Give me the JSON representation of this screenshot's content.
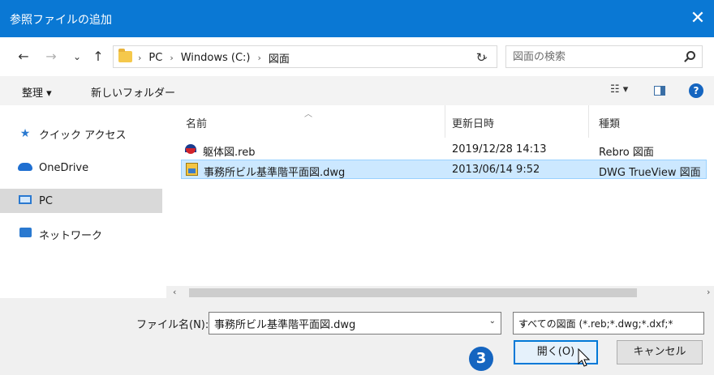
{
  "dialog": {
    "title": "参照ファイルの追加",
    "close_glyph": "✕"
  },
  "nav": {
    "back_glyph": "←",
    "forward_glyph": "→",
    "recent_glyph": "⌄",
    "up_glyph": "↑",
    "breadcrumb": [
      {
        "label": "PC"
      },
      {
        "label": "Windows (C:)"
      },
      {
        "label": "図面"
      }
    ],
    "separator": "›",
    "dropdown_glyph": "⌄",
    "refresh_glyph": "↻",
    "search_placeholder": "図面の検索"
  },
  "toolbar": {
    "organize_label": "整理 ▾",
    "new_folder_label": "新しいフォルダー",
    "view_label": "☷ ▾",
    "help_label": "?"
  },
  "sidebar": {
    "items": [
      {
        "label": "クイック アクセス",
        "icon": "star-icon",
        "selected": false
      },
      {
        "label": "OneDrive",
        "icon": "cloud-icon",
        "selected": false
      },
      {
        "label": "PC",
        "icon": "monitor-icon",
        "selected": true
      },
      {
        "label": "ネットワーク",
        "icon": "network-icon",
        "selected": false
      }
    ]
  },
  "files": {
    "columns": [
      "名前",
      "更新日時",
      "種類"
    ],
    "sort_glyph": "︿",
    "rows": [
      {
        "name": "躯体図.reb",
        "date": "2019/12/28 14:13",
        "type": "Rebro 図面",
        "icon": "rebro-file-icon",
        "selected": false
      },
      {
        "name": "事務所ビル基準階平面図.dwg",
        "date": "2013/06/14 9:52",
        "type": "DWG TrueView 図面",
        "icon": "dwg-file-icon",
        "selected": true
      }
    ]
  },
  "scrollbar": {
    "left_glyph": "‹",
    "right_glyph": "›"
  },
  "footer": {
    "filename_label": "ファイル名(N):",
    "filename_value": "事務所ビル基準階平面図.dwg",
    "filetype_value": "すべての図面 (*.reb;*.dwg;*.dxf;*",
    "dropdown_glyph": "⌄",
    "open_label": "開く(O)",
    "cancel_label": "キャンセル",
    "step_badge": "3"
  }
}
